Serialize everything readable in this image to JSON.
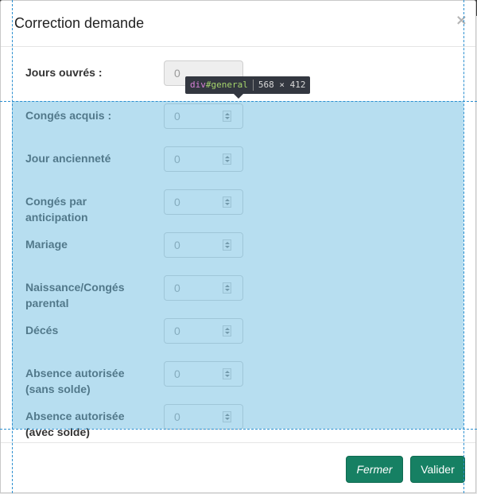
{
  "modal": {
    "title": "Correction demande",
    "close_glyph": "×"
  },
  "form": {
    "fields": [
      {
        "label": "Jours ouvrés :",
        "value": "0",
        "disabled": true
      },
      {
        "label": "Congés acquis :",
        "value": "0"
      },
      {
        "label": "Jour ancienneté",
        "value": "0"
      },
      {
        "label": "Congés par anticipation",
        "value": "0"
      },
      {
        "label": "Mariage",
        "value": "0"
      },
      {
        "label": "Naissance/Congés parental",
        "value": "0"
      },
      {
        "label": "Décés",
        "value": "0"
      },
      {
        "label": "Absence autorisée (sans solde)",
        "value": "0"
      },
      {
        "label": "Absence autorisée (avec solde)",
        "value": "0"
      }
    ]
  },
  "devtools": {
    "tag": "div",
    "id_text": "#general",
    "size": "568 × 412",
    "highlight_color": "#6fbde1"
  },
  "footer": {
    "close_label": "Fermer",
    "validate_label": "Valider",
    "button_color": "#168063"
  },
  "icons": {
    "close": "close-icon",
    "spinner_up": "chevron-up-icon",
    "spinner_down": "chevron-down-icon"
  }
}
